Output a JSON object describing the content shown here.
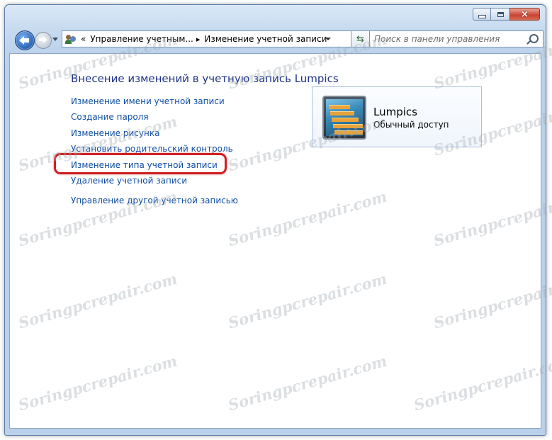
{
  "window": {
    "min_label": "",
    "max_label": "",
    "close_label": "×"
  },
  "address": {
    "chevrons": "«",
    "crumb1": "Управление учетным...",
    "separator": "▸",
    "crumb2": "Изменение учетной записи"
  },
  "search": {
    "placeholder": "Поиск в панели управления"
  },
  "main": {
    "title": "Внесение изменений в учетную запись Lumpics",
    "links": [
      "Изменение имени учетной записи",
      "Создание пароля",
      "Изменение рисунка",
      "Установить родительский контроль",
      "Изменение типа учетной записи",
      "Удаление учетной записи"
    ],
    "other_link": "Управление другой учетной записью",
    "highlighted_link_index": 4,
    "highlight_color": "#d11f1f"
  },
  "account": {
    "name": "Lumpics",
    "type": "Обычный доступ"
  },
  "watermark": "Soringpcrepair.com",
  "colors": {
    "link": "#0f4da3",
    "title": "#1e3287"
  }
}
